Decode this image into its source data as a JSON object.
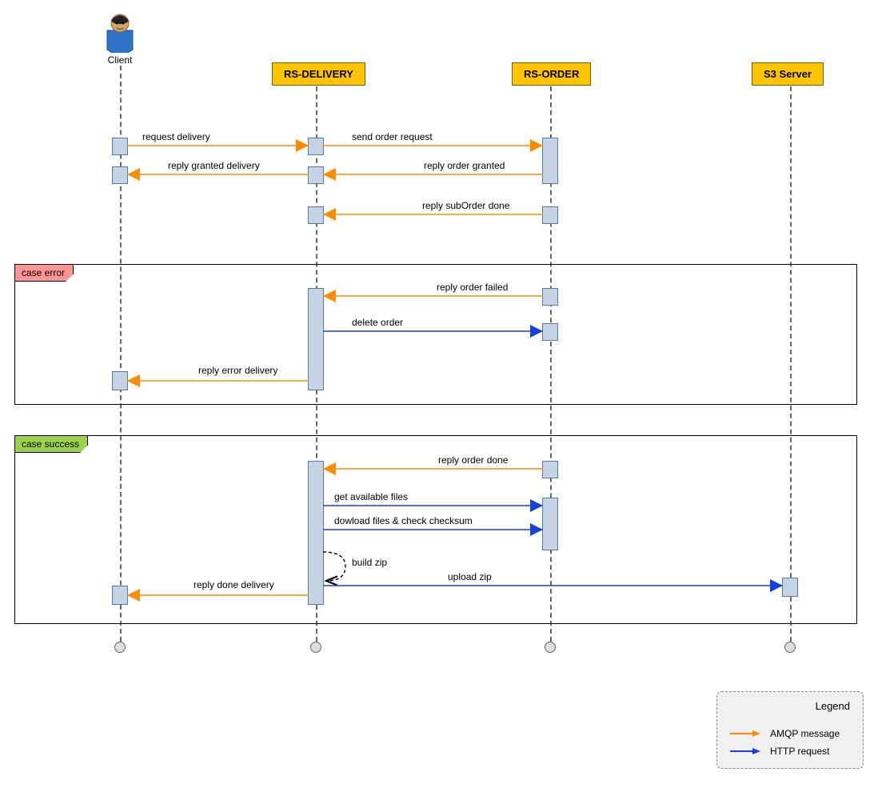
{
  "participants": {
    "client": "Client",
    "delivery": "RS-DELIVERY",
    "order": "RS-ORDER",
    "s3": "S3 Server"
  },
  "fragments": {
    "error": "case error",
    "success": "case success"
  },
  "messages": {
    "request_delivery": "request delivery",
    "send_order_request": "send order request",
    "reply_order_granted": "reply order granted",
    "reply_granted_delivery": "reply granted delivery",
    "reply_suborder_done": "reply subOrder done",
    "reply_order_failed": "reply order failed",
    "delete_order": "delete order",
    "reply_error_delivery": "reply error delivery",
    "reply_order_done": "reply order done",
    "get_available_files": "get available files",
    "download_files": "dowload files & check checksum",
    "build_zip": "build zip",
    "upload_zip": "upload zip",
    "reply_done_delivery": "reply done delivery"
  },
  "legend": {
    "title": "Legend",
    "amqp": "AMQP message",
    "http": "HTTP request"
  },
  "colors": {
    "amqp": "#ff8c00",
    "http": "#1a3fe0",
    "participant_fill": "#ffc400",
    "activation_fill": "#c4d4e4",
    "frag_error": "#ff9494",
    "frag_success": "#9bd24c"
  }
}
